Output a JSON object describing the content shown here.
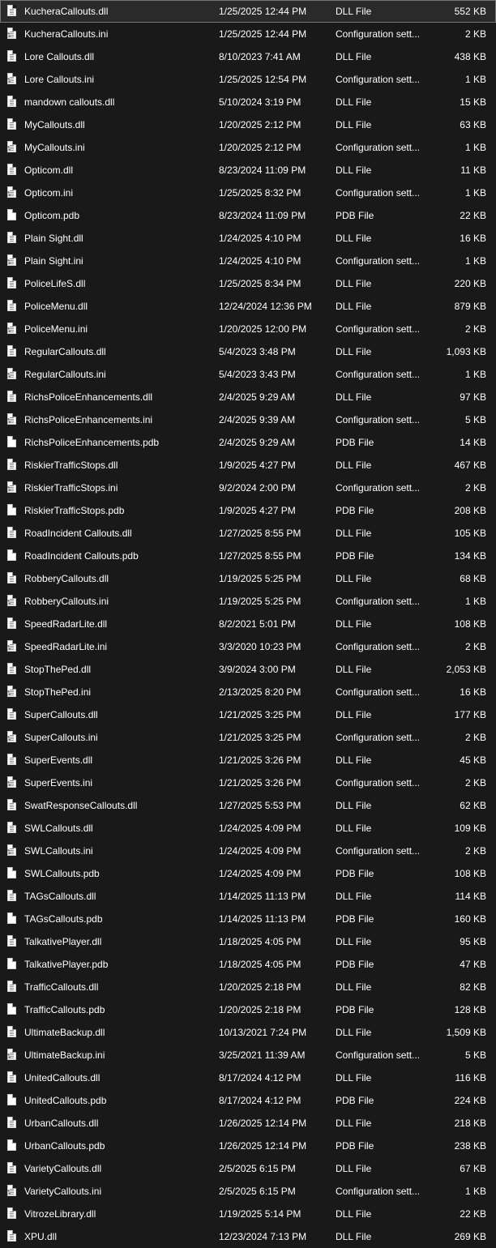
{
  "files": [
    {
      "name": "KucheraCallouts.dll",
      "date": "1/25/2025 12:44 PM",
      "type": "DLL File",
      "size": "552 KB",
      "icon": "dll-file-icon",
      "selected": true
    },
    {
      "name": "KucheraCallouts.ini",
      "date": "1/25/2025 12:44 PM",
      "type": "Configuration sett...",
      "size": "2 KB",
      "icon": "config-file-icon"
    },
    {
      "name": "Lore Callouts.dll",
      "date": "8/10/2023 7:41 AM",
      "type": "DLL File",
      "size": "438 KB",
      "icon": "dll-file-icon"
    },
    {
      "name": "Lore Callouts.ini",
      "date": "1/25/2025 12:54 PM",
      "type": "Configuration sett...",
      "size": "1 KB",
      "icon": "config-file-icon"
    },
    {
      "name": "mandown callouts.dll",
      "date": "5/10/2024 3:19 PM",
      "type": "DLL File",
      "size": "15 KB",
      "icon": "dll-file-icon"
    },
    {
      "name": "MyCallouts.dll",
      "date": "1/20/2025 2:12 PM",
      "type": "DLL File",
      "size": "63 KB",
      "icon": "dll-file-icon"
    },
    {
      "name": "MyCallouts.ini",
      "date": "1/20/2025 2:12 PM",
      "type": "Configuration sett...",
      "size": "1 KB",
      "icon": "config-file-icon"
    },
    {
      "name": "Opticom.dll",
      "date": "8/23/2024 11:09 PM",
      "type": "DLL File",
      "size": "11 KB",
      "icon": "dll-file-icon"
    },
    {
      "name": "Opticom.ini",
      "date": "1/25/2025 8:32 PM",
      "type": "Configuration sett...",
      "size": "1 KB",
      "icon": "config-file-icon"
    },
    {
      "name": "Opticom.pdb",
      "date": "8/23/2024 11:09 PM",
      "type": "PDB File",
      "size": "22 KB",
      "icon": "pdb-file-icon"
    },
    {
      "name": "Plain Sight.dll",
      "date": "1/24/2025 4:10 PM",
      "type": "DLL File",
      "size": "16 KB",
      "icon": "dll-file-icon"
    },
    {
      "name": "Plain Sight.ini",
      "date": "1/24/2025 4:10 PM",
      "type": "Configuration sett...",
      "size": "1 KB",
      "icon": "config-file-icon"
    },
    {
      "name": "PoliceLifeS.dll",
      "date": "1/25/2025 8:34 PM",
      "type": "DLL File",
      "size": "220 KB",
      "icon": "dll-file-icon"
    },
    {
      "name": "PoliceMenu.dll",
      "date": "12/24/2024 12:36 PM",
      "type": "DLL File",
      "size": "879 KB",
      "icon": "dll-file-icon"
    },
    {
      "name": "PoliceMenu.ini",
      "date": "1/20/2025 12:00 PM",
      "type": "Configuration sett...",
      "size": "2 KB",
      "icon": "config-file-icon"
    },
    {
      "name": "RegularCallouts.dll",
      "date": "5/4/2023 3:48 PM",
      "type": "DLL File",
      "size": "1,093 KB",
      "icon": "dll-file-icon"
    },
    {
      "name": "RegularCallouts.ini",
      "date": "5/4/2023 3:43 PM",
      "type": "Configuration sett...",
      "size": "1 KB",
      "icon": "config-file-icon"
    },
    {
      "name": "RichsPoliceEnhancements.dll",
      "date": "2/4/2025 9:29 AM",
      "type": "DLL File",
      "size": "97 KB",
      "icon": "dll-file-icon"
    },
    {
      "name": "RichsPoliceEnhancements.ini",
      "date": "2/4/2025 9:39 AM",
      "type": "Configuration sett...",
      "size": "5 KB",
      "icon": "config-file-icon"
    },
    {
      "name": "RichsPoliceEnhancements.pdb",
      "date": "2/4/2025 9:29 AM",
      "type": "PDB File",
      "size": "14 KB",
      "icon": "pdb-file-icon"
    },
    {
      "name": "RiskierTrafficStops.dll",
      "date": "1/9/2025 4:27 PM",
      "type": "DLL File",
      "size": "467 KB",
      "icon": "dll-file-icon"
    },
    {
      "name": "RiskierTrafficStops.ini",
      "date": "9/2/2024 2:00 PM",
      "type": "Configuration sett...",
      "size": "2 KB",
      "icon": "config-file-icon"
    },
    {
      "name": "RiskierTrafficStops.pdb",
      "date": "1/9/2025 4:27 PM",
      "type": "PDB File",
      "size": "208 KB",
      "icon": "pdb-file-icon"
    },
    {
      "name": "RoadIncident Callouts.dll",
      "date": "1/27/2025 8:55 PM",
      "type": "DLL File",
      "size": "105 KB",
      "icon": "dll-file-icon"
    },
    {
      "name": "RoadIncident Callouts.pdb",
      "date": "1/27/2025 8:55 PM",
      "type": "PDB File",
      "size": "134 KB",
      "icon": "pdb-file-icon"
    },
    {
      "name": "RobberyCallouts.dll",
      "date": "1/19/2025 5:25 PM",
      "type": "DLL File",
      "size": "68 KB",
      "icon": "dll-file-icon"
    },
    {
      "name": "RobberyCallouts.ini",
      "date": "1/19/2025 5:25 PM",
      "type": "Configuration sett...",
      "size": "1 KB",
      "icon": "config-file-icon"
    },
    {
      "name": "SpeedRadarLite.dll",
      "date": "8/2/2021 5:01 PM",
      "type": "DLL File",
      "size": "108 KB",
      "icon": "dll-file-icon"
    },
    {
      "name": "SpeedRadarLite.ini",
      "date": "3/3/2020 10:23 PM",
      "type": "Configuration sett...",
      "size": "2 KB",
      "icon": "config-file-icon"
    },
    {
      "name": "StopThePed.dll",
      "date": "3/9/2024 3:00 PM",
      "type": "DLL File",
      "size": "2,053 KB",
      "icon": "dll-file-icon"
    },
    {
      "name": "StopThePed.ini",
      "date": "2/13/2025 8:20 PM",
      "type": "Configuration sett...",
      "size": "16 KB",
      "icon": "config-file-icon"
    },
    {
      "name": "SuperCallouts.dll",
      "date": "1/21/2025 3:25 PM",
      "type": "DLL File",
      "size": "177 KB",
      "icon": "dll-file-icon"
    },
    {
      "name": "SuperCallouts.ini",
      "date": "1/21/2025 3:25 PM",
      "type": "Configuration sett...",
      "size": "2 KB",
      "icon": "config-file-icon"
    },
    {
      "name": "SuperEvents.dll",
      "date": "1/21/2025 3:26 PM",
      "type": "DLL File",
      "size": "45 KB",
      "icon": "dll-file-icon"
    },
    {
      "name": "SuperEvents.ini",
      "date": "1/21/2025 3:26 PM",
      "type": "Configuration sett...",
      "size": "2 KB",
      "icon": "config-file-icon"
    },
    {
      "name": "SwatResponseCallouts.dll",
      "date": "1/27/2025 5:53 PM",
      "type": "DLL File",
      "size": "62 KB",
      "icon": "dll-file-icon"
    },
    {
      "name": "SWLCallouts.dll",
      "date": "1/24/2025 4:09 PM",
      "type": "DLL File",
      "size": "109 KB",
      "icon": "dll-file-icon"
    },
    {
      "name": "SWLCallouts.ini",
      "date": "1/24/2025 4:09 PM",
      "type": "Configuration sett...",
      "size": "2 KB",
      "icon": "config-file-icon"
    },
    {
      "name": "SWLCallouts.pdb",
      "date": "1/24/2025 4:09 PM",
      "type": "PDB File",
      "size": "108 KB",
      "icon": "pdb-file-icon"
    },
    {
      "name": "TAGsCallouts.dll",
      "date": "1/14/2025 11:13 PM",
      "type": "DLL File",
      "size": "114 KB",
      "icon": "dll-file-icon"
    },
    {
      "name": "TAGsCallouts.pdb",
      "date": "1/14/2025 11:13 PM",
      "type": "PDB File",
      "size": "160 KB",
      "icon": "pdb-file-icon"
    },
    {
      "name": "TalkativePlayer.dll",
      "date": "1/18/2025 4:05 PM",
      "type": "DLL File",
      "size": "95 KB",
      "icon": "dll-file-icon"
    },
    {
      "name": "TalkativePlayer.pdb",
      "date": "1/18/2025 4:05 PM",
      "type": "PDB File",
      "size": "47 KB",
      "icon": "pdb-file-icon"
    },
    {
      "name": "TrafficCallouts.dll",
      "date": "1/20/2025 2:18 PM",
      "type": "DLL File",
      "size": "82 KB",
      "icon": "dll-file-icon"
    },
    {
      "name": "TrafficCallouts.pdb",
      "date": "1/20/2025 2:18 PM",
      "type": "PDB File",
      "size": "128 KB",
      "icon": "pdb-file-icon"
    },
    {
      "name": "UltimateBackup.dll",
      "date": "10/13/2021 7:24 PM",
      "type": "DLL File",
      "size": "1,509 KB",
      "icon": "dll-file-icon"
    },
    {
      "name": "UltimateBackup.ini",
      "date": "3/25/2021 11:39 AM",
      "type": "Configuration sett...",
      "size": "5 KB",
      "icon": "config-file-icon"
    },
    {
      "name": "UnitedCallouts.dll",
      "date": "8/17/2024 4:12 PM",
      "type": "DLL File",
      "size": "116 KB",
      "icon": "dll-file-icon"
    },
    {
      "name": "UnitedCallouts.pdb",
      "date": "8/17/2024 4:12 PM",
      "type": "PDB File",
      "size": "224 KB",
      "icon": "pdb-file-icon"
    },
    {
      "name": "UrbanCallouts.dll",
      "date": "1/26/2025 12:14 PM",
      "type": "DLL File",
      "size": "218 KB",
      "icon": "dll-file-icon"
    },
    {
      "name": "UrbanCallouts.pdb",
      "date": "1/26/2025 12:14 PM",
      "type": "PDB File",
      "size": "238 KB",
      "icon": "pdb-file-icon"
    },
    {
      "name": "VarietyCallouts.dll",
      "date": "2/5/2025 6:15 PM",
      "type": "DLL File",
      "size": "67 KB",
      "icon": "dll-file-icon"
    },
    {
      "name": "VarietyCallouts.ini",
      "date": "2/5/2025 6:15 PM",
      "type": "Configuration sett...",
      "size": "1 KB",
      "icon": "config-file-icon"
    },
    {
      "name": "VitrozeLibrary.dll",
      "date": "1/19/2025 5:14 PM",
      "type": "DLL File",
      "size": "22 KB",
      "icon": "dll-file-icon"
    },
    {
      "name": "XPU.dll",
      "date": "12/23/2024 7:13 PM",
      "type": "DLL File",
      "size": "269 KB",
      "icon": "dll-file-icon"
    }
  ]
}
